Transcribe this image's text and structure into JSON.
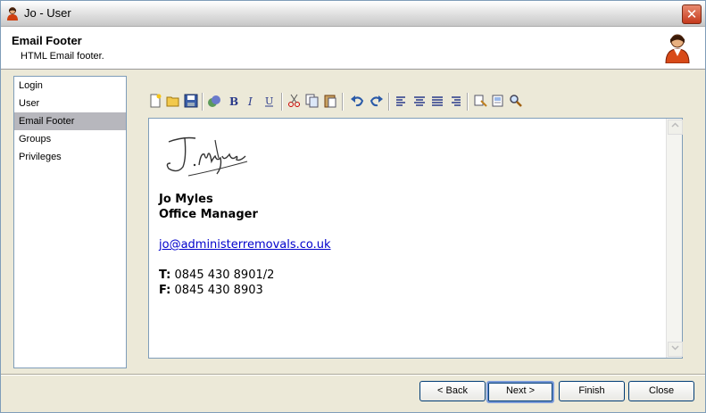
{
  "window": {
    "title": "Jo - User",
    "close_glyph": "✕"
  },
  "header": {
    "title": "Email Footer",
    "subtitle": "HTML Email footer."
  },
  "nav": {
    "items": [
      {
        "label": "Login"
      },
      {
        "label": "User"
      },
      {
        "label": "Email Footer"
      },
      {
        "label": "Groups"
      },
      {
        "label": "Privileges"
      }
    ]
  },
  "toolbar": {
    "icons": [
      "new-icon",
      "open-icon",
      "save-icon",
      "insert-image-icon",
      "bold-icon",
      "italic-icon",
      "underline-icon",
      "cut-icon",
      "copy-icon",
      "paste-icon",
      "undo-icon",
      "redo-icon",
      "align-left-icon",
      "align-center-icon",
      "align-justify-icon",
      "align-right-icon",
      "copy-format-icon",
      "preview-icon",
      "find-icon"
    ]
  },
  "editor": {
    "signature_text": "J.Myles",
    "name": "Jo Myles",
    "job_title": "Office Manager",
    "email": "jo@administerremovals.co.uk",
    "phone_label": "T:",
    "phone": "0845 430 8901/2",
    "fax_label": "F:",
    "fax": "0845 430 8903"
  },
  "buttons": {
    "back": "< Back",
    "next": "Next >",
    "finish": "Finish",
    "close": "Close"
  },
  "colors": {
    "selected_nav": "#b7b7bd",
    "link": "#0000cc",
    "close_red": "#c5391c"
  }
}
